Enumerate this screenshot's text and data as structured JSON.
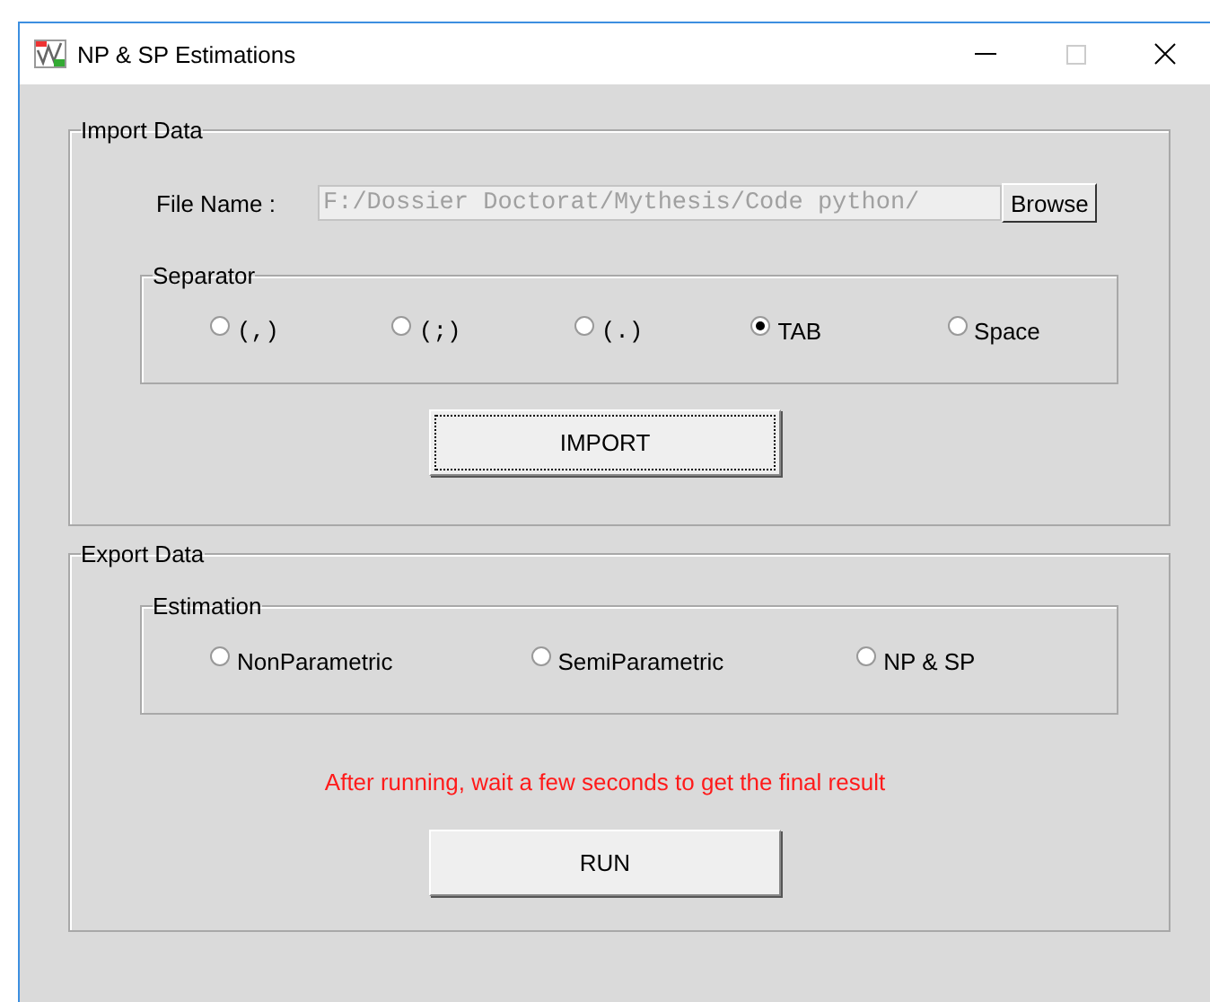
{
  "window": {
    "title": "NP & SP Estimations"
  },
  "import_data": {
    "title": "Import Data",
    "file_name": {
      "label": "File Name :",
      "value": "F:/Dossier Doctorat/Mythesis/Code python/"
    },
    "browse_button": "Browse",
    "separator": {
      "title": "Separator",
      "options": [
        {
          "label": "(,)",
          "selected": false
        },
        {
          "label": "(;)",
          "selected": false
        },
        {
          "label": "(.)",
          "selected": false
        },
        {
          "label": "TAB",
          "selected": true
        },
        {
          "label": "Space",
          "selected": false
        }
      ]
    },
    "import_button": "IMPORT"
  },
  "export_data": {
    "title": "Export Data",
    "estimation": {
      "title": "Estimation",
      "options": [
        {
          "label": "NonParametric",
          "selected": false
        },
        {
          "label": "SemiParametric",
          "selected": false
        },
        {
          "label": "NP & SP",
          "selected": false
        }
      ]
    },
    "message": "After running, wait a few seconds to get the final result",
    "run_button": "RUN"
  }
}
